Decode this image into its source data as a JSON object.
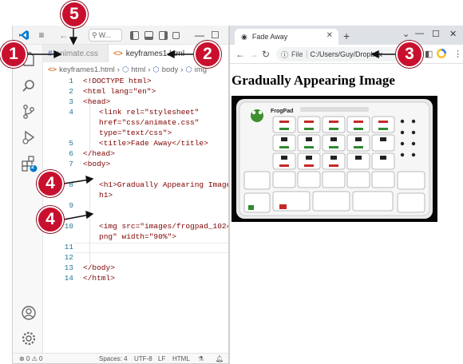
{
  "colors": {
    "callout": "#c8102e",
    "vscode_accent": "#007acc",
    "html_tag": "#800000",
    "html_attr": "#e50000",
    "html_value": "#0000ff"
  },
  "vscode": {
    "search_text": "W...",
    "tabs": [
      {
        "label": "animate.css",
        "icon": "css-file-icon"
      },
      {
        "label": "keyframes1.html",
        "icon": "html-file-icon"
      }
    ],
    "breadcrumb": [
      "keyframes1.html",
      "html",
      "body",
      "img"
    ],
    "code_lines": [
      {
        "n": "1",
        "text": "<!DOCTYPE html>"
      },
      {
        "n": "2",
        "text": "<html lang=\"en\">"
      },
      {
        "n": "3",
        "text": "<head>"
      },
      {
        "n": "4",
        "text": "<link rel=\"stylesheet\""
      },
      {
        "n": "",
        "text": "href=\"css/animate.css\""
      },
      {
        "n": "",
        "text": "type=\"text/css\">"
      },
      {
        "n": "5",
        "text": "<title>Fade Away</title>"
      },
      {
        "n": "6",
        "text": "</head>"
      },
      {
        "n": "7",
        "text": "<body>"
      },
      {
        "n": "8",
        "text": ""
      },
      {
        "n": "9",
        "text": "<h1>Gradually Appearing Image</"
      },
      {
        "n": "",
        "text": "h1>"
      },
      {
        "n": "10",
        "text": ""
      },
      {
        "n": "11",
        "text": "<img src=\"images/frogpad_1024."
      },
      {
        "n": "",
        "text": "png\" width=\"90%\">"
      },
      {
        "n": "12",
        "text": ""
      },
      {
        "n": "13",
        "text": "</body>"
      },
      {
        "n": "14",
        "text": "</html>"
      }
    ],
    "status": {
      "problems": "⊗ 0 ⚠ 0",
      "spaces": "Spaces: 4",
      "encoding": "UTF-8",
      "eol": "LF",
      "language": "HTML"
    },
    "extensions_badge": "2"
  },
  "chrome": {
    "tab_title": "Fade Away",
    "address_scheme": "File",
    "address_path": "C:/Users/Guy/Dropbox",
    "page_heading": "Gradually Appearing Image",
    "image_alt": "FrogPad keyboard photo",
    "keypad_brand": "FrogPad"
  },
  "callouts": [
    "1",
    "2",
    "3",
    "4",
    "4",
    "5"
  ]
}
